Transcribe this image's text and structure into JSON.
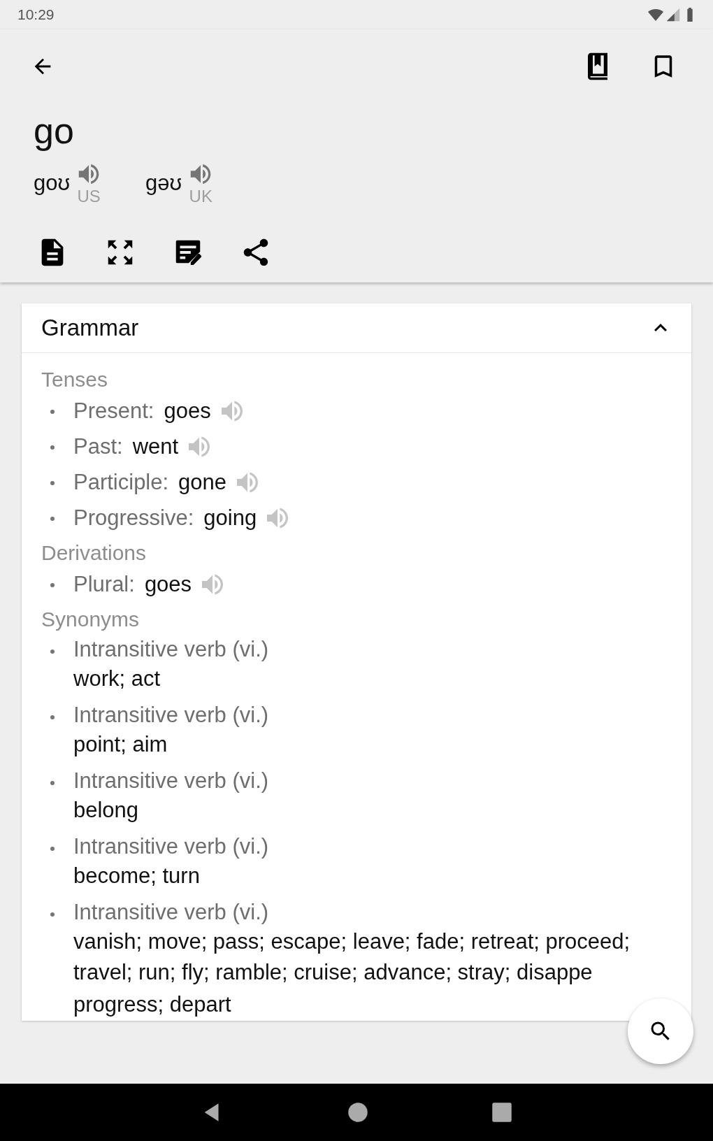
{
  "status_bar": {
    "time": "10:29"
  },
  "word": "go",
  "pronunciations": [
    {
      "ipa": "goʊ",
      "region": "US"
    },
    {
      "ipa": "gəʊ",
      "region": "UK"
    }
  ],
  "card": {
    "title": "Grammar",
    "expanded": true,
    "sections": [
      {
        "heading": "Tenses",
        "items": [
          {
            "kind": "form",
            "label": "Present:",
            "value": "goes"
          },
          {
            "kind": "form",
            "label": "Past:",
            "value": "went"
          },
          {
            "kind": "form",
            "label": "Participle:",
            "value": "gone"
          },
          {
            "kind": "form",
            "label": "Progressive:",
            "value": "going"
          }
        ]
      },
      {
        "heading": "Derivations",
        "items": [
          {
            "kind": "form",
            "label": "Plural:",
            "value": "goes"
          }
        ]
      },
      {
        "heading": "Synonyms",
        "items": [
          {
            "kind": "sense",
            "label": "Intransitive verb (vi.)",
            "lines": [
              "work; act"
            ]
          },
          {
            "kind": "sense",
            "label": "Intransitive verb (vi.)",
            "lines": [
              "point; aim"
            ]
          },
          {
            "kind": "sense",
            "label": "Intransitive verb (vi.)",
            "lines": [
              "belong"
            ]
          },
          {
            "kind": "sense",
            "label": "Intransitive verb (vi.)",
            "lines": [
              "become; turn"
            ]
          },
          {
            "kind": "sense",
            "label": "Intransitive verb (vi.)",
            "lines": [
              "vanish; move; pass; escape; leave; fade; retreat; proceed;",
              "travel; run; fly; ramble; cruise; advance; stray; disappe",
              "progress; depart"
            ]
          }
        ]
      }
    ]
  }
}
